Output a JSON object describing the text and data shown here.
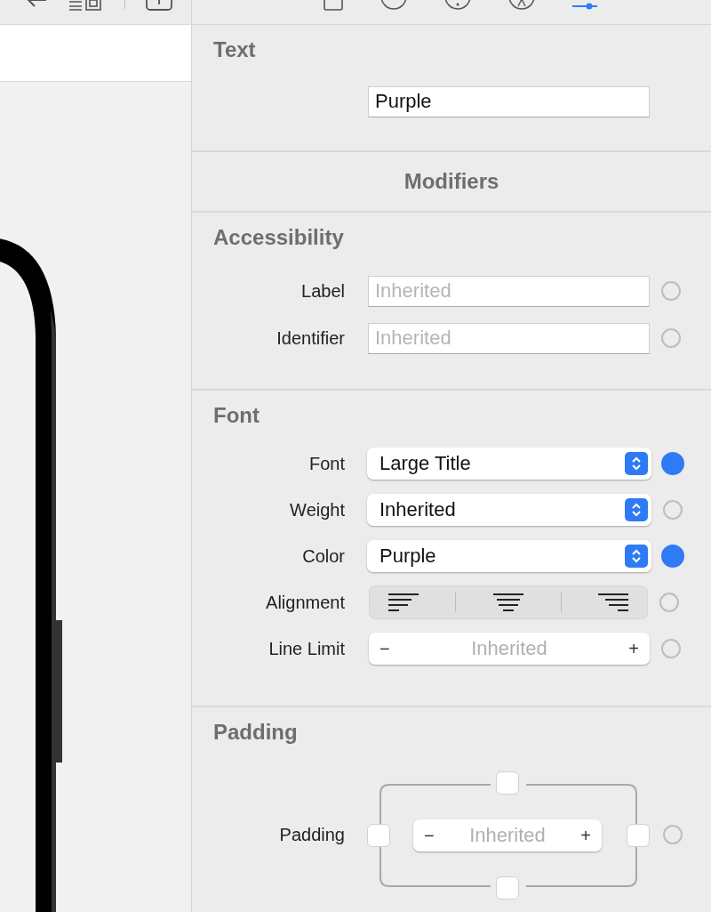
{
  "editor_toolbar": [
    {
      "kind": "back"
    },
    {
      "kind": "list"
    },
    {
      "kind": "divider"
    },
    {
      "kind": "add"
    }
  ],
  "inspector_tabs": [
    {
      "kind": "file",
      "selected": false
    },
    {
      "kind": "history",
      "selected": false
    },
    {
      "kind": "help",
      "selected": false
    },
    {
      "kind": "accessibility",
      "selected": false
    },
    {
      "kind": "attributes",
      "selected": true
    }
  ],
  "text_section": {
    "title": "Text",
    "value": "Purple"
  },
  "modifiers_header": "Modifiers",
  "accessibility": {
    "title": "Accessibility",
    "rows": [
      {
        "label": "Label",
        "placeholder": "Inherited",
        "set": false
      },
      {
        "label": "Identifier",
        "placeholder": "Inherited",
        "set": false
      }
    ]
  },
  "font": {
    "title": "Font",
    "rows": [
      {
        "kind": "popup",
        "label": "Font",
        "value": "Large Title",
        "set": true
      },
      {
        "kind": "popup",
        "label": "Weight",
        "value": "Inherited",
        "set": false
      },
      {
        "kind": "popup",
        "label": "Color",
        "value": "Purple",
        "set": true
      },
      {
        "kind": "alignment",
        "label": "Alignment",
        "set": false
      },
      {
        "kind": "stepper",
        "label": "Line Limit",
        "minus": "−",
        "placeholder": "Inherited",
        "plus": "+",
        "set": false
      }
    ]
  },
  "padding": {
    "title": "Padding",
    "label": "Padding",
    "minus": "−",
    "placeholder": "Inherited",
    "plus": "+",
    "set": false,
    "edges": [
      {
        "checked": false
      },
      {
        "checked": false
      },
      {
        "checked": false
      },
      {
        "checked": false
      }
    ]
  }
}
